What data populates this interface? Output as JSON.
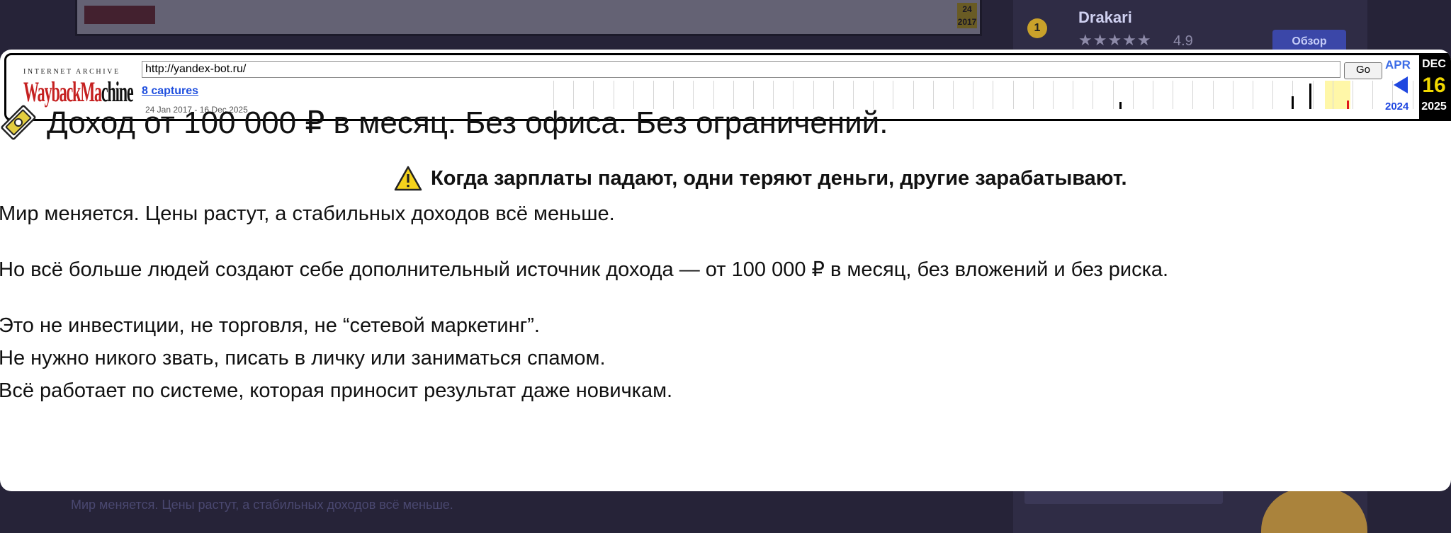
{
  "background": {
    "sidebar": {
      "rank": "1",
      "name": "Drakari",
      "stars": "★★★★★",
      "rating": "4.9",
      "button_label": "Обзор"
    },
    "toolbar_date": "24\n2017",
    "footer_text": "Мир меняется. Цены растут, а стабильных доходов всё меньше."
  },
  "wayback": {
    "logo_top": "INTERNET ARCHIVE",
    "logo_main_red": "WaybackMa",
    "logo_main_dark": "chine",
    "url": "http://yandex-bot.ru/",
    "go_label": "Go",
    "captures": "8 captures",
    "range": "24 Jan 2017 - 16 Dec 2025",
    "prev": {
      "month": "APR",
      "year": "2024"
    },
    "current": {
      "month": "DEC",
      "day": "16",
      "year": "2025"
    }
  },
  "article": {
    "headline": "Доход от 100 000 ₽ в месяц. Без офиса. Без ограничений.",
    "warning": "Когда зарплаты падают, одни теряют деньги, другие зарабатывают.",
    "p1": "Мир меняется. Цены растут, а стабильных доходов всё меньше.",
    "p2": "Но всё больше людей создают себе дополнительный источник дохода — от 100 000 ₽ в месяц, без вложений и без риска.",
    "p3_line1": "Это не инвестиции, не торговля, не “сетевой маркетинг”.",
    "p3_line2": "Не нужно никого звать, писать в личку или заниматься спамом.",
    "p3_line3": "Всё работает по системе, которая приносит результат даже новичкам."
  },
  "colors": {
    "page_bg": "#262338",
    "wayback_red": "#c52020",
    "link_blue": "#1e4ede",
    "highlight_yellow": "#f0d800"
  }
}
